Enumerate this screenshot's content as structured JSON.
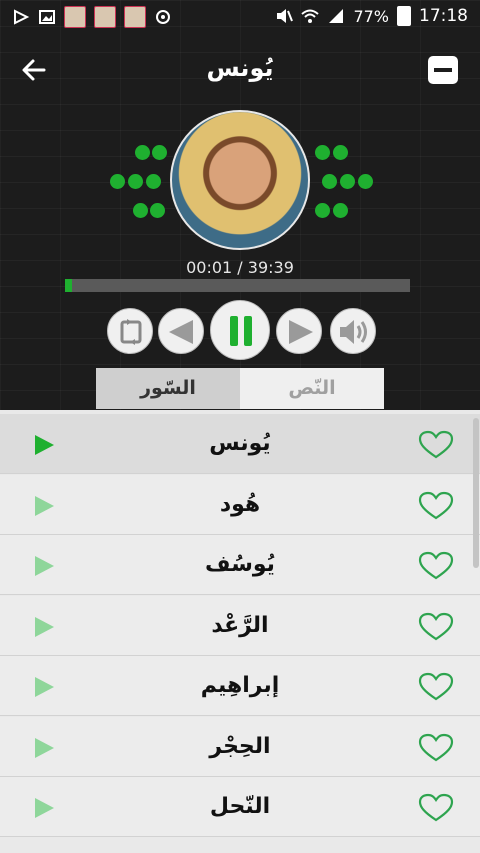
{
  "status_bar": {
    "battery_percent": "77%",
    "time": "17:18"
  },
  "app_bar": {
    "title": "يُونس"
  },
  "player": {
    "time_readout": "00:01 / 39:39",
    "progress_fraction": 0.02
  },
  "tabs": {
    "surahs_label": "السّور",
    "text_label": "النّص"
  },
  "surahs": [
    {
      "name": "يُونس",
      "active": true
    },
    {
      "name": "هُود",
      "active": false
    },
    {
      "name": "يُوسُف",
      "active": false
    },
    {
      "name": "الرَّعْد",
      "active": false
    },
    {
      "name": "إبراهِيم",
      "active": false
    },
    {
      "name": "الحِجْر",
      "active": false
    },
    {
      "name": "النّحل",
      "active": false
    }
  ],
  "colors": {
    "accent": "#1fb030",
    "play_active": "#1fb030",
    "play_inactive": "#8ed69a",
    "heart": "#2ea44f"
  },
  "icons": {
    "back": "arrow-left-icon",
    "menu": "menu-icon",
    "repeat": "repeat-icon",
    "previous": "previous-icon",
    "pause": "pause-icon",
    "next": "next-icon",
    "volume": "volume-icon",
    "play": "play-icon",
    "favorite": "heart-icon"
  }
}
